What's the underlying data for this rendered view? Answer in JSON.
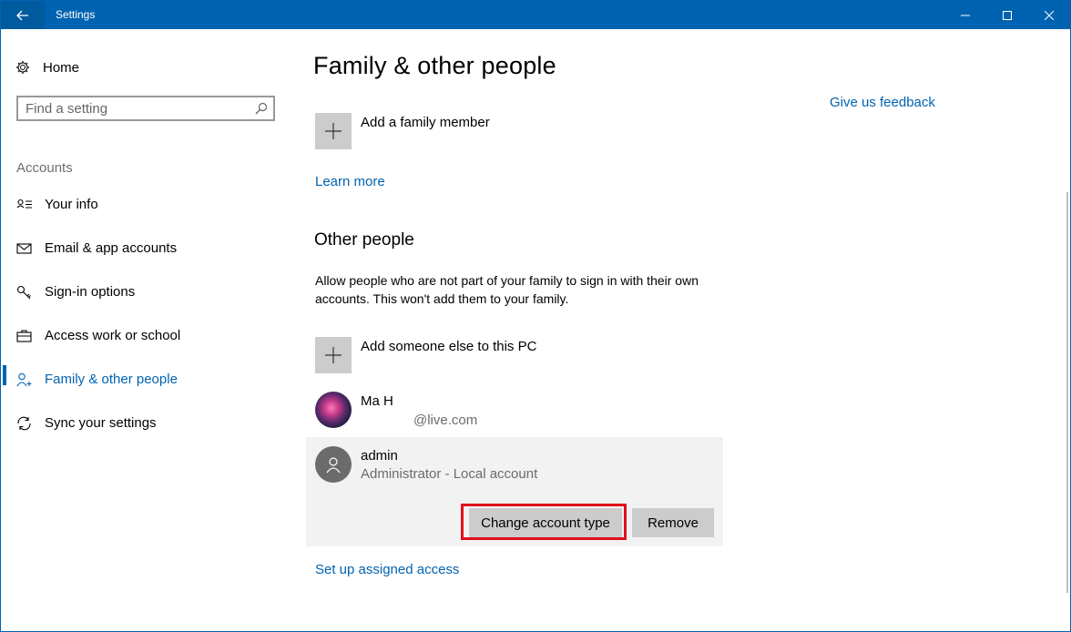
{
  "window": {
    "title": "Settings"
  },
  "sidebar": {
    "home_label": "Home",
    "search_placeholder": "Find a setting",
    "section_label": "Accounts",
    "items": [
      {
        "label": "Your info",
        "icon": "contact-card-icon"
      },
      {
        "label": "Email & app accounts",
        "icon": "mail-icon"
      },
      {
        "label": "Sign-in options",
        "icon": "key-icon"
      },
      {
        "label": "Access work or school",
        "icon": "briefcase-icon"
      },
      {
        "label": "Family & other people",
        "icon": "person-add-icon",
        "selected": true
      },
      {
        "label": "Sync your settings",
        "icon": "sync-icon"
      }
    ]
  },
  "main": {
    "title": "Family & other people",
    "feedback_link": "Give us feedback",
    "add_family_label": "Add a family member",
    "learn_more": "Learn more",
    "other_people_title": "Other people",
    "other_people_desc": "Allow people who are not part of your family to sign in with their own accounts. This won't add them to your family.",
    "add_someone_label": "Add someone else to this PC",
    "people": [
      {
        "name": "Ma H",
        "detail": "@live.com"
      },
      {
        "name": "admin",
        "detail": "Administrator - Local account"
      }
    ],
    "change_account_type": "Change account type",
    "remove": "Remove",
    "assigned_access": "Set up assigned access"
  },
  "colors": {
    "accent": "#0063b1",
    "highlight": "#e0101a"
  }
}
